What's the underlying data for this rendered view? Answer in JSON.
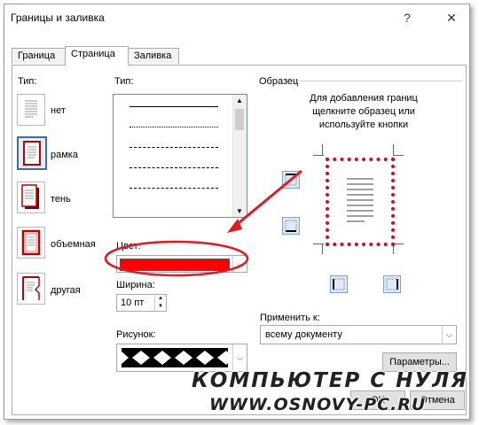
{
  "window": {
    "title": "Границы и заливка",
    "help_label": "?",
    "close_label": "✕"
  },
  "tabs": [
    {
      "label": "Граница",
      "active": false
    },
    {
      "label": "Страница",
      "active": true
    },
    {
      "label": "Заливка",
      "active": false
    }
  ],
  "setting": {
    "label": "Тип:",
    "items": [
      {
        "label": "нет",
        "selected": false
      },
      {
        "label": "рамка",
        "selected": true
      },
      {
        "label": "тень",
        "selected": false
      },
      {
        "label": "объемная",
        "selected": true
      },
      {
        "label": "другая",
        "selected": false
      }
    ]
  },
  "style": {
    "label": "Тип:",
    "lines": [
      "solid",
      "dotted",
      "dashed-fine",
      "dashed",
      "dash-dot"
    ]
  },
  "color": {
    "label": "Цвет:",
    "value_color": "#ff0000"
  },
  "width": {
    "label": "Ширина:",
    "value": "10 пт"
  },
  "art": {
    "label": "Рисунок:"
  },
  "preview": {
    "label": "Образец",
    "hint_line1": "Для добавления границ",
    "hint_line2": "щелкните образец или",
    "hint_line3": "используйте кнопки",
    "border_color": "#e8001c"
  },
  "apply_to": {
    "label": "Применить к:",
    "value": "всему документу"
  },
  "buttons": {
    "options": "Параметры...",
    "ok": "OK",
    "cancel": "Отмена"
  },
  "watermark": {
    "line1": "КОМПЬЮТЕР С НУЛЯ",
    "line2": "WWW.OSNOVY-PC.RU"
  },
  "annotation": {
    "accent_color": "#e8171f"
  }
}
